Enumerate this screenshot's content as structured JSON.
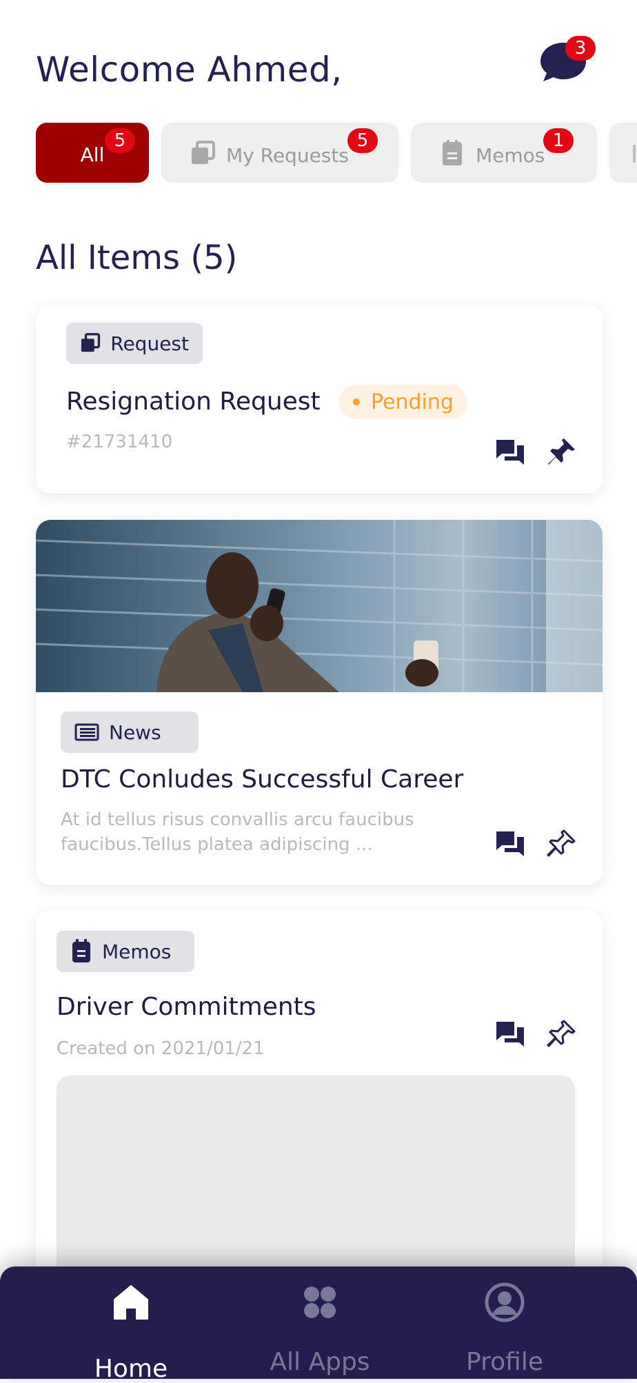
{
  "header": {
    "welcome": "Welcome Ahmed,",
    "chat_badge": "3"
  },
  "tabs": [
    {
      "label": "All",
      "badge": "5",
      "icon": "none",
      "active": true
    },
    {
      "label": "My Requests",
      "badge": "5",
      "icon": "requests-icon",
      "active": false
    },
    {
      "label": "Memos",
      "badge": "1",
      "icon": "memo-icon",
      "active": false
    }
  ],
  "section": {
    "title": "All Items (5)"
  },
  "cards": [
    {
      "type_label": "Request",
      "title": "Resignation Request",
      "status": "Pending",
      "id": "#21731410"
    },
    {
      "type_label": "News",
      "title": "DTC Conludes Successful Career",
      "excerpt_line1": "At id tellus risus convallis arcu faucibus",
      "excerpt_line2": "faucibus.Tellus platea adipiscing ..."
    },
    {
      "type_label": "Memos",
      "title": "Driver Commitments",
      "date": "Created on 2021/01/21"
    }
  ],
  "nav": [
    {
      "label": "Home",
      "icon": "home-icon",
      "active": true
    },
    {
      "label": "All Apps",
      "icon": "apps-icon",
      "active": false
    },
    {
      "label": "Profile",
      "icon": "profile-icon",
      "active": false
    }
  ],
  "colors": {
    "primary": "#24204f",
    "accent": "#9e0000",
    "badge": "#e30613",
    "pending": "#f6a02d"
  }
}
